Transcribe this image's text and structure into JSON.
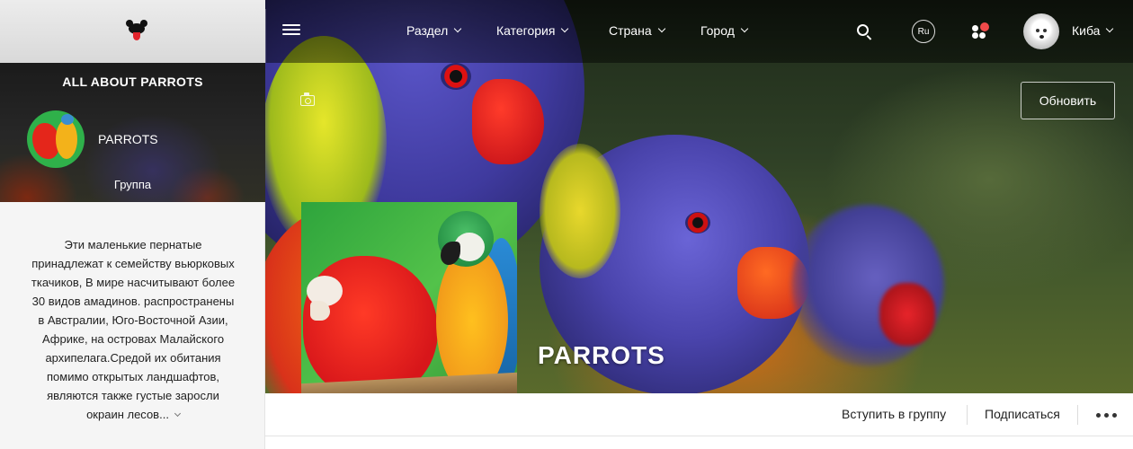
{
  "topbar": {
    "nav": [
      {
        "label": "Раздел"
      },
      {
        "label": "Категория"
      },
      {
        "label": "Страна"
      },
      {
        "label": "Город"
      }
    ],
    "language": "Ru",
    "user_name": "Киба",
    "notification_dot_color": "#f04a4a"
  },
  "icons": {
    "logo": "dog-logo-icon",
    "menu": "hamburger-menu-icon",
    "search": "search-icon",
    "notifications": "apps-dots-icon",
    "camera": "camera-icon",
    "more": "more-dots-icon"
  },
  "cover": {
    "title": "PARROTS",
    "refresh_label": "Обновить"
  },
  "sidebar": {
    "title": "ALL ABOUT PARROTS",
    "group_name": "PARROTS",
    "group_type": "Группа",
    "description_lines": [
      "Эти маленькие пернатые",
      "принадлежат к семейству вьюрковых",
      "ткачиков, В мире насчитывают более",
      "30 видов амадинов. распространены",
      "в Австралии, Юго-Восточной Азии,",
      "Африке, на островах Малайского",
      "архипелага.Средой их обитания",
      "помимо открытых ландшафтов,",
      "являются также густые заросли",
      "окраин лесов..."
    ]
  },
  "actions": {
    "join": "Вступить в группу",
    "subscribe": "Подписаться"
  }
}
